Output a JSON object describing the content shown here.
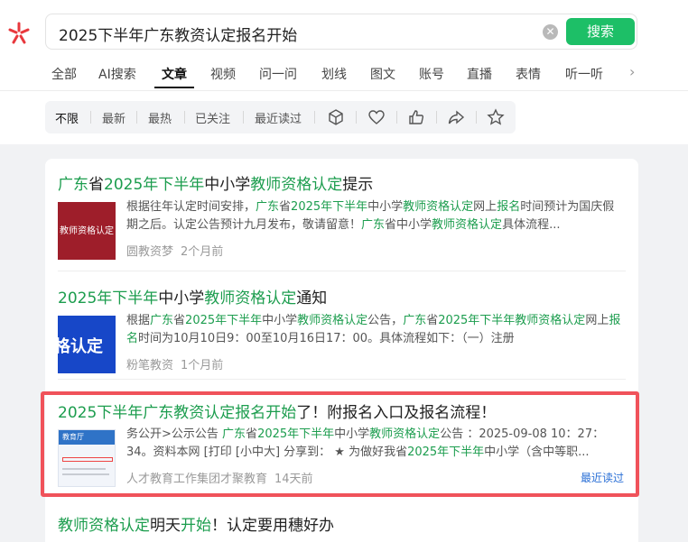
{
  "search": {
    "query": "2025下半年广东教资认定报名开始",
    "clear_icon": "clear-icon",
    "button_label": "搜索"
  },
  "tabs": [
    {
      "label": "全部"
    },
    {
      "label": "AI搜索"
    },
    {
      "label": "文章",
      "active": true
    },
    {
      "label": "视频"
    },
    {
      "label": "问一问"
    },
    {
      "label": "划线"
    },
    {
      "label": "图文"
    },
    {
      "label": "账号"
    },
    {
      "label": "直播"
    },
    {
      "label": "表情"
    },
    {
      "label": "听一听"
    }
  ],
  "filters": [
    {
      "label": "不限",
      "active": true
    },
    {
      "label": "最新"
    },
    {
      "label": "最热"
    },
    {
      "label": "已关注"
    },
    {
      "label": "最近读过"
    }
  ],
  "filter_icons": [
    "cube-icon",
    "heart-icon",
    "thumbs-up-icon",
    "share-icon",
    "star-icon"
  ],
  "results": [
    {
      "title_parts": [
        {
          "t": "广东",
          "hl": true
        },
        {
          "t": "省",
          "hl": false
        },
        {
          "t": "2025年下半年",
          "hl": true
        },
        {
          "t": "中小学",
          "hl": false
        },
        {
          "t": "教师资格认定",
          "hl": true
        },
        {
          "t": "提示",
          "hl": false
        }
      ],
      "thumb_text": "教师资格认定",
      "snippet_parts": [
        {
          "t": "根据往年认定时间安排，",
          "hl": false
        },
        {
          "t": "广东",
          "hl": true
        },
        {
          "t": "省",
          "hl": false
        },
        {
          "t": "2025年下半年",
          "hl": true
        },
        {
          "t": "中小学",
          "hl": false
        },
        {
          "t": "教师资格认定",
          "hl": true
        },
        {
          "t": "网上",
          "hl": false
        },
        {
          "t": "报名",
          "hl": true
        },
        {
          "t": "时间预计为国庆假期之后。认定公告预计九月发布，敬请留意！",
          "hl": false
        },
        {
          "t": "广东",
          "hl": true
        },
        {
          "t": "省中小学",
          "hl": false
        },
        {
          "t": "教师资格认定",
          "hl": true
        },
        {
          "t": "具体流程...",
          "hl": false
        }
      ],
      "source": "圆教资梦",
      "time": "2个月前"
    },
    {
      "title_parts": [
        {
          "t": "2025年下半年",
          "hl": true
        },
        {
          "t": "中小学",
          "hl": false
        },
        {
          "t": "教师资格认定",
          "hl": true
        },
        {
          "t": "通知",
          "hl": false
        }
      ],
      "thumb_text": "格认定",
      "snippet_parts": [
        {
          "t": "根据",
          "hl": false
        },
        {
          "t": "广东",
          "hl": true
        },
        {
          "t": "省",
          "hl": false
        },
        {
          "t": "2025年下半年",
          "hl": true
        },
        {
          "t": "中小学",
          "hl": false
        },
        {
          "t": "教师资格认定",
          "hl": true
        },
        {
          "t": "公告，",
          "hl": false
        },
        {
          "t": "广东",
          "hl": true
        },
        {
          "t": "省",
          "hl": false
        },
        {
          "t": "2025年下半年教师资格认定",
          "hl": true
        },
        {
          "t": "网上",
          "hl": false
        },
        {
          "t": "报名",
          "hl": true
        },
        {
          "t": "时间为10月10日9：00至10月16日17：00。具体流程如下：（一）注册",
          "hl": false
        }
      ],
      "source": "粉笔教资",
      "time": "1个月前"
    },
    {
      "title_parts": [
        {
          "t": "2025下半年广东教资认定报名开始",
          "hl": true
        },
        {
          "t": "了！附报名入口及报名流程！",
          "hl": false
        }
      ],
      "thumb_text": "教育厅",
      "snippet_parts": [
        {
          "t": "务公开>公示公告 ",
          "hl": false
        },
        {
          "t": "广东",
          "hl": true
        },
        {
          "t": "省",
          "hl": false
        },
        {
          "t": "2025年下半年",
          "hl": true
        },
        {
          "t": "中小学",
          "hl": false
        },
        {
          "t": "教师资格认定",
          "hl": true
        },
        {
          "t": "公告 ：2025-09-08 10：27：34。资料本网 [打印 [小中大] 分享到： ★ 为做好我省",
          "hl": false
        },
        {
          "t": "2025年下半年",
          "hl": true
        },
        {
          "t": "中小学（含中等职...",
          "hl": false
        }
      ],
      "source": "人才教育工作集团才聚教育",
      "time": "14天前",
      "recent_label": "最近读过"
    },
    {
      "title_parts": [
        {
          "t": "教师资格认定",
          "hl": true
        },
        {
          "t": "明天",
          "hl": false
        },
        {
          "t": "开始",
          "hl": true
        },
        {
          "t": "！认定要用穗好办",
          "hl": false
        }
      ]
    }
  ]
}
